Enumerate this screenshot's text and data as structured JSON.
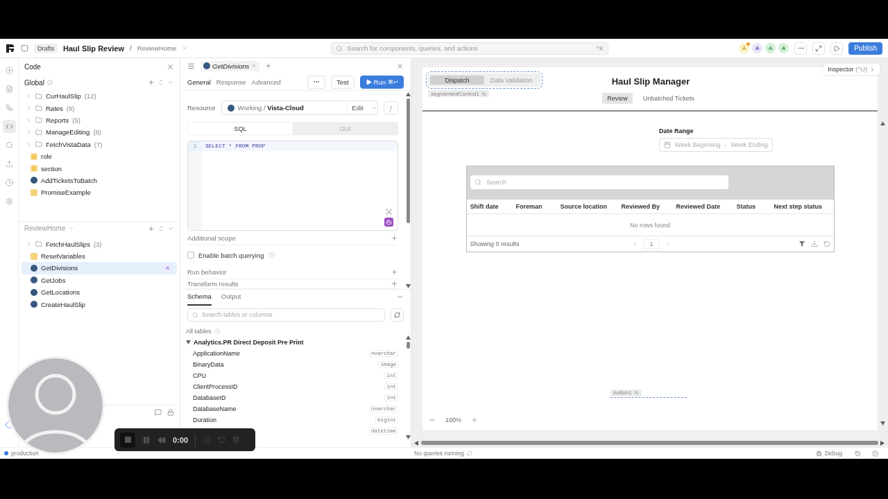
{
  "topbar": {
    "badge": "Drafts",
    "app_name": "Haul Slip Review",
    "separator": "/",
    "page": "ReviewHome",
    "search": {
      "placeholder": "Search for components, queries, and actions",
      "shortcut": "^K"
    },
    "presence": [
      {
        "initial": "A",
        "color": "#c9a227",
        "notified": true
      },
      {
        "initial": "A",
        "color": "#6b5fc4",
        "notified": false
      },
      {
        "initial": "A",
        "color": "#3a9a4f",
        "notified": false
      },
      {
        "initial": "A",
        "color": "#3a9a4f",
        "notified": false
      }
    ],
    "publish": "Publish"
  },
  "rail": [
    {
      "kind": "add",
      "selected": false
    },
    {
      "kind": "pages",
      "selected": false
    },
    {
      "kind": "components",
      "selected": false
    },
    {
      "kind": "code",
      "selected": true
    },
    {
      "kind": "search",
      "selected": false
    },
    {
      "kind": "state",
      "selected": false
    },
    {
      "kind": "history",
      "selected": false
    },
    {
      "kind": "settings",
      "selected": false
    }
  ],
  "code_panel": {
    "title": "Code",
    "global": {
      "label": "Global",
      "items": [
        {
          "kind": "folder",
          "name": "CurHaulSlip",
          "count": "(12)",
          "selected": false
        },
        {
          "kind": "folder",
          "name": "Rates",
          "count": "(9)",
          "selected": false
        },
        {
          "kind": "folder",
          "name": "Reports",
          "count": "(5)",
          "selected": false
        },
        {
          "kind": "folder",
          "name": "ManageEditing",
          "count": "(8)",
          "selected": false
        },
        {
          "kind": "folder",
          "name": "FetchVistaData",
          "count": "(7)",
          "selected": false
        },
        {
          "kind": "variable",
          "name": "role",
          "selected": false
        },
        {
          "kind": "variable",
          "name": "section",
          "selected": false
        },
        {
          "kind": "sql",
          "name": "AddTicketsToBatch",
          "selected": false
        },
        {
          "kind": "js",
          "name": "PromiseExample",
          "selected": false
        }
      ]
    },
    "page": {
      "label": "ReviewHome",
      "items": [
        {
          "kind": "folder",
          "name": "FetchHaulSlips",
          "count": "(3)",
          "selected": false
        },
        {
          "kind": "js",
          "name": "ResetVariables",
          "selected": false
        },
        {
          "kind": "sql",
          "name": "GetDivisions",
          "badge": "A",
          "selected": true
        },
        {
          "kind": "sql",
          "name": "GetJobs",
          "selected": false
        },
        {
          "kind": "sql",
          "name": "GetLocations",
          "selected": false
        },
        {
          "kind": "sql",
          "name": "CreateHaulSlip",
          "selected": false
        }
      ]
    }
  },
  "query_editor": {
    "tab": "GetDivisions",
    "sections": [
      {
        "label": "General",
        "selected": true
      },
      {
        "label": "Response",
        "selected": false
      },
      {
        "label": "Advanced",
        "selected": false
      }
    ],
    "test": "Test",
    "run": {
      "label": "Run",
      "shortcut": "⌘↩"
    },
    "resource": {
      "label": "Resource",
      "workspace": "Working",
      "separator": "/",
      "name": "Vista-Cloud",
      "edit": "Edit",
      "function_symbol": "ƒ"
    },
    "modes": [
      {
        "label": "SQL",
        "selected": true
      },
      {
        "label": "GUI",
        "selected": false
      }
    ],
    "code": [
      {
        "line": "1",
        "text": "SELECT * FROM PROP"
      }
    ],
    "options": [
      {
        "kind": "section",
        "label": "Additional scope"
      },
      {
        "kind": "checkbox",
        "label": "Enable batch querying",
        "checked": false
      },
      {
        "kind": "section",
        "label": "Run behavior"
      },
      {
        "kind": "section",
        "label": "Transform results"
      }
    ]
  },
  "schema": {
    "tabs": [
      {
        "label": "Schema",
        "selected": true
      },
      {
        "label": "Output",
        "selected": false
      }
    ],
    "search": {
      "placeholder": "Search tables or columns"
    },
    "all_tables": "All tables",
    "table": {
      "name": "Analytics.PR Direct Deposit Pre Print",
      "expanded": true,
      "columns": [
        {
          "name": "ApplicationName",
          "type": "nvarchar"
        },
        {
          "name": "BinaryData",
          "type": "image"
        },
        {
          "name": "CPU",
          "type": "int"
        },
        {
          "name": "ClientProcessID",
          "type": "int"
        },
        {
          "name": "DatabaseID",
          "type": "int"
        },
        {
          "name": "DatabaseName",
          "type": "nvarchar"
        },
        {
          "name": "Duration",
          "type": "bigint"
        },
        {
          "type": "datetime"
        }
      ]
    }
  },
  "canvas": {
    "segmented": {
      "options": [
        {
          "label": "Dispatch",
          "selected": true
        },
        {
          "label": "Data Validation",
          "selected": false
        }
      ],
      "tag": "segmentedControl1"
    },
    "title": "Haul Slip Manager",
    "tabs": [
      {
        "label": "Review",
        "selected": true
      },
      {
        "label": "Unbatched Tickets",
        "selected": false
      }
    ],
    "inspector": {
      "label": "Inspector",
      "shortcut": "(^U)"
    },
    "date_range": {
      "label": "Date Range",
      "start_placeholder": "Week Beginning",
      "separator": "-",
      "end_placeholder": "Week Ending"
    },
    "table": {
      "search": {
        "placeholder": "Search"
      },
      "columns": [
        "Shift date",
        "Foreman",
        "Source location",
        "Reviewed By",
        "Reviewed Date",
        "Status",
        "Next step status"
      ],
      "empty": "No rows found",
      "summary": "Showing 0 results",
      "page": "1"
    },
    "button_tag": "button1",
    "zoom": "100%"
  },
  "status_bar": {
    "environment": "production",
    "queries": "No queries running",
    "debug": "Debug"
  },
  "recorder": {
    "time": "0:00"
  }
}
